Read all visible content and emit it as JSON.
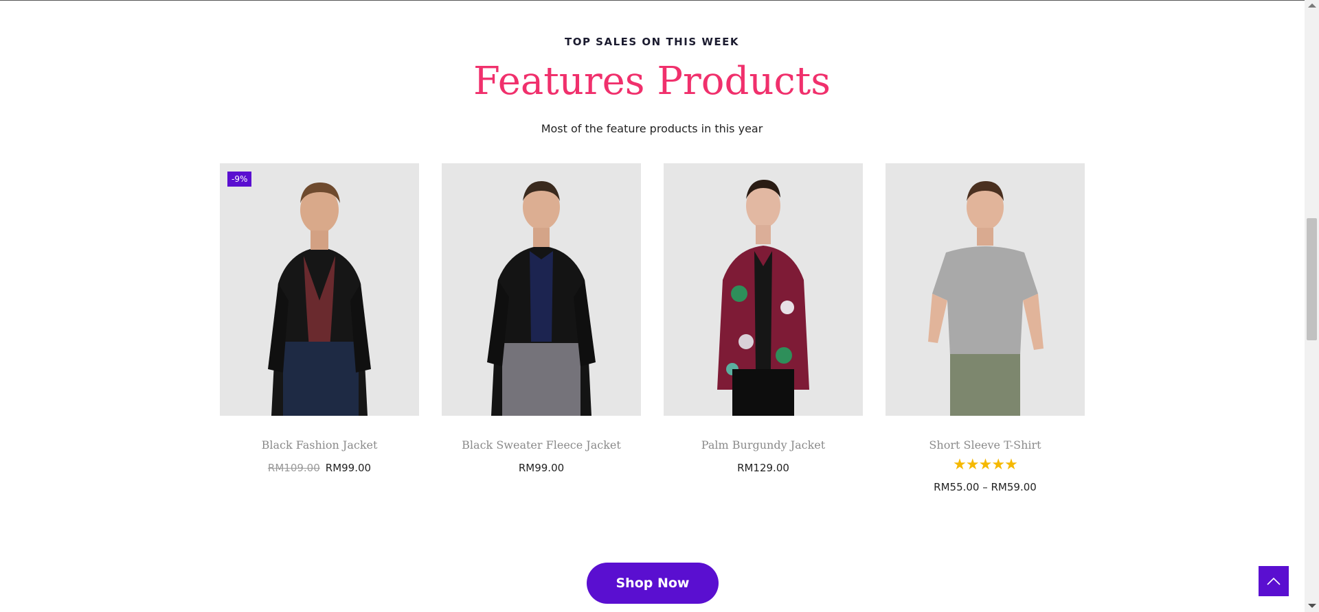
{
  "section": {
    "kicker": "TOP SALES ON THIS WEEK",
    "title": "Features Products",
    "subtitle": "Most of the feature products in this year"
  },
  "products": [
    {
      "name": "Black Fashion Jacket",
      "badge": "-9%",
      "old_price": "RM109.00",
      "price": "RM99.00"
    },
    {
      "name": "Black Sweater Fleece Jacket",
      "price": "RM99.00"
    },
    {
      "name": "Palm Burgundy Jacket",
      "price": "RM129.00"
    },
    {
      "name": "Short Sleeve T-Shirt",
      "rating": 5,
      "rating_max": 5,
      "price": "RM55.00 – RM59.00"
    }
  ],
  "cta": {
    "label": "Shop Now"
  },
  "icons": {
    "back_to_top": "chevron-up-icon"
  },
  "colors": {
    "accent": "#5a0fd0",
    "title": "#f0306c",
    "star": "#f5b800"
  }
}
